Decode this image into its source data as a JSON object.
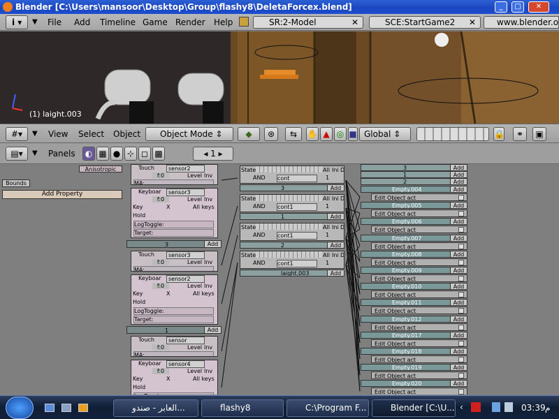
{
  "window": {
    "title": "Blender [C:\\Users\\mansoor\\Desktop\\Group\\flashy8\\DeletaForcex.blend]"
  },
  "menu": {
    "items": [
      "File",
      "Add",
      "Timeline",
      "Game",
      "Render",
      "Help"
    ]
  },
  "scene_field": "SR:2-Model",
  "scene2_field": "SCE:StartGame2",
  "url": "www.blender.o",
  "viewport": {
    "object_label": "(1) laight.003"
  },
  "header3d": {
    "view": "View",
    "select": "Select",
    "object": "Object",
    "mode": "Object Mode",
    "orientation": "Global"
  },
  "logic_header": {
    "panels": "Panels",
    "page": "1"
  },
  "left_panel": {
    "anisotropic": "Anisotropic",
    "bounds": "Bounds",
    "add_property": "Add Property"
  },
  "sensors": [
    {
      "type": "Touch",
      "name": "sensor2",
      "ma": "MA:"
    },
    {
      "type": "Keyboar",
      "name": "sensor3",
      "key": "Key",
      "keyval": "X",
      "allkeys": "All keys",
      "hold": "Hold",
      "logtoggle": "LogToggle:",
      "target": "Target:"
    },
    {
      "header_label": "3",
      "add": "Add"
    },
    {
      "type": "Touch",
      "name": "sensor3",
      "ma": "MA:"
    },
    {
      "type": "Keyboar",
      "name": "sensor2",
      "key": "Key",
      "keyval": "X",
      "allkeys": "All keys",
      "hold": "Hold",
      "logtoggle": "LogToggle:",
      "target": "Target:"
    },
    {
      "header_label": "1",
      "add": "Add"
    },
    {
      "type": "Touch",
      "name": "sensor",
      "ma": "MA:"
    },
    {
      "type": "Keyboar",
      "name": "sensor4",
      "key": "Key",
      "keyval": "X",
      "allkeys": "All keys",
      "hold": "Hold",
      "logtoggle": "LogToggle:"
    }
  ],
  "sensor_common": {
    "level": "Level",
    "inv": "Inv",
    "freq": "f:0"
  },
  "controllers": [
    {
      "state": "State",
      "and": "AND",
      "name": "cont",
      "num": "1",
      "all": "All",
      "ini": "Ini",
      "d": "D",
      "label": "3",
      "add": "Add"
    },
    {
      "state": "State",
      "and": "AND",
      "name": "cont1",
      "num": "1",
      "all": "All",
      "ini": "Ini",
      "d": "D",
      "label": "1",
      "add": "Add"
    },
    {
      "state": "State",
      "and": "AND",
      "name": "cont1",
      "num": "1",
      "all": "All",
      "ini": "Ini",
      "d": "D",
      "label": "2",
      "add": "Add"
    },
    {
      "state": "State",
      "and": "AND",
      "name": "cont1",
      "num": "1",
      "all": "All",
      "ini": "Ini",
      "d": "D",
      "label": "laight.003",
      "add": "Add"
    }
  ],
  "actuator_top": [
    {
      "label": "3",
      "add": "Add"
    },
    {
      "label": "1",
      "add": "Add"
    },
    {
      "label": "2",
      "add": "Add"
    }
  ],
  "actuators": [
    {
      "name": "Empty.004",
      "act": "Edit Object act",
      "add": "Add"
    },
    {
      "name": "Empty.005",
      "act": "Edit Object act",
      "add": "Add"
    },
    {
      "name": "Empty.006",
      "act": "Edit Object act",
      "add": "Add"
    },
    {
      "name": "Empty.007",
      "act": "Edit Object act",
      "add": "Add"
    },
    {
      "name": "Empty.008",
      "act": "Edit Object act",
      "add": "Add"
    },
    {
      "name": "Empty.009",
      "act": "Edit Object act",
      "add": "Add"
    },
    {
      "name": "Empty.010",
      "act": "Edit Object act",
      "add": "Add"
    },
    {
      "name": "Empty.011",
      "act": "Edit Object act",
      "add": "Add"
    },
    {
      "name": "Empty.012",
      "act": "Edit Object act",
      "add": "Add"
    },
    {
      "name": "Empty.017",
      "act": "Edit Object act",
      "add": "Add"
    },
    {
      "name": "Empty.018",
      "act": "Edit Object act",
      "add": "Add"
    },
    {
      "name": "Empty.019",
      "act": "Edit Object act",
      "add": "Add"
    },
    {
      "name": "Empty.020",
      "act": "Edit Object act",
      "add": "Add"
    }
  ],
  "taskbar": {
    "items": [
      "العابر - صندو...",
      "flashy8",
      "C:\\Program F...",
      "Blender [C:\\U..."
    ],
    "time": "03:39",
    "ampm": "م"
  }
}
